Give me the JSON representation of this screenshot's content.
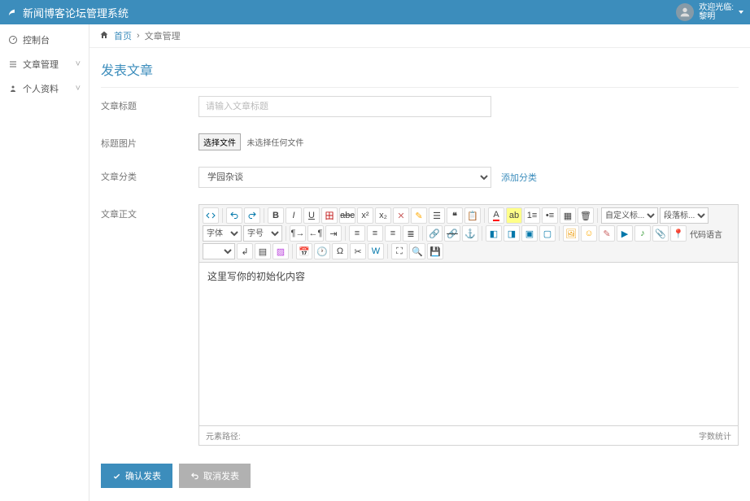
{
  "brand": "新闻博客论坛管理系统",
  "user": {
    "welcome": "欢迎光临:",
    "name": "黎明"
  },
  "sidebar": {
    "items": [
      {
        "label": "控制台",
        "expandable": false
      },
      {
        "label": "文章管理",
        "expandable": true
      },
      {
        "label": "个人资料",
        "expandable": true
      }
    ]
  },
  "breadcrumb": {
    "home": "首页",
    "current": "文章管理",
    "sep": "›"
  },
  "page_title": "发表文章",
  "form": {
    "title_label": "文章标题",
    "title_placeholder": "请输入文章标题",
    "image_label": "标题图片",
    "file_btn": "选择文件",
    "file_status": "未选择任何文件",
    "cat_label": "文章分类",
    "cat_selected": "学园杂谈",
    "add_cat": "添加分类",
    "body_label": "文章正文"
  },
  "editor": {
    "fontname_sel": "自定义标...",
    "para_sel": "段落标...",
    "fontfam_sel": "字体",
    "fontsize_sel": "字号",
    "code_lang_label": "代码语言",
    "content": "这里写你的初始化内容",
    "path": "元素路径:",
    "stats": "字数统计"
  },
  "buttons": {
    "submit": "确认发表",
    "cancel": "取消发表"
  }
}
